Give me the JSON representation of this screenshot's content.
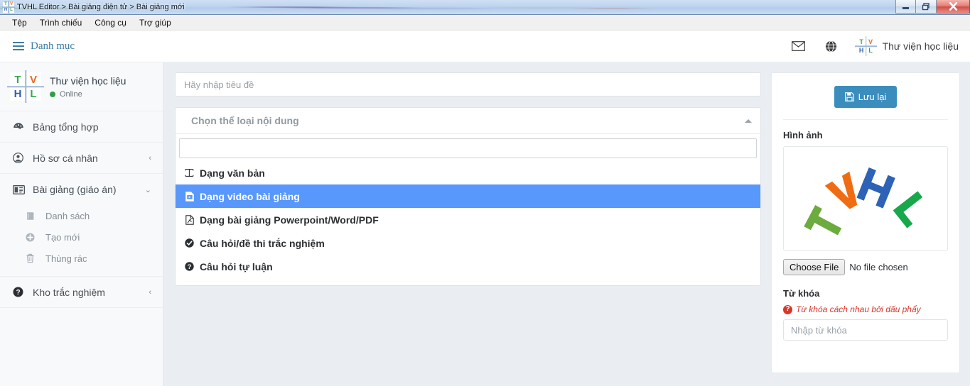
{
  "window": {
    "title": "TVHL Editor > Bài giảng điện tử > Bài giảng mới",
    "minimize_label": "Minimize",
    "restore_label": "Restore",
    "close_label": "Close"
  },
  "menubar": {
    "items": [
      {
        "label": "Tệp"
      },
      {
        "label": "Trình chiếu"
      },
      {
        "label": "Công cụ"
      },
      {
        "label": "Trợ giúp"
      }
    ]
  },
  "header": {
    "menu_toggle_label": "Danh mục",
    "mail_icon": "envelope-icon",
    "globe_icon": "globe-icon",
    "user_name": "Thư viện học liệu"
  },
  "logo": {
    "t": "T",
    "v": "V",
    "h": "H",
    "l": "L"
  },
  "sidebar": {
    "profile": {
      "name": "Thư viện học liệu",
      "status": "Online"
    },
    "items": [
      {
        "label": "Bảng tổng hợp",
        "icon": "dashboard-icon",
        "caret": ""
      },
      {
        "label": "Hồ sơ cá nhân",
        "icon": "user-circle-icon",
        "caret": "‹"
      },
      {
        "label": "Bài giảng (giáo án)",
        "icon": "book-open-icon",
        "caret": "⌄"
      },
      {
        "label": "Kho trắc nghiệm",
        "icon": "question-circle-icon",
        "caret": "‹"
      }
    ],
    "sub_items": [
      {
        "label": "Danh sách",
        "icon": "book-icon"
      },
      {
        "label": "Tạo mới",
        "icon": "plus-circle-icon"
      },
      {
        "label": "Thùng rác",
        "icon": "trash-icon"
      }
    ]
  },
  "form": {
    "title_placeholder": "Hãy nhập tiêu đề",
    "title_value": "",
    "select_label": "Chọn thể loại nội dung",
    "select_caret_icon": "caret-up-icon",
    "search_value": "",
    "search_placeholder": "",
    "options": [
      {
        "label": "Dạng văn bản",
        "icon": "text-height-icon",
        "selected": false
      },
      {
        "label": "Dạng video bài giảng",
        "icon": "video-file-icon",
        "selected": true
      },
      {
        "label": "Dạng bài giảng Powerpoint/Word/PDF",
        "icon": "pdf-file-icon",
        "selected": false
      },
      {
        "label": "Câu hỏi/đề thi trắc nghiệm",
        "icon": "check-circle-icon",
        "selected": false
      },
      {
        "label": "Câu hỏi tự luận",
        "icon": "question-circle-icon",
        "selected": false
      }
    ]
  },
  "panel": {
    "save_label": "Lưu lại",
    "save_icon": "floppy-disk-icon",
    "image_label": "Hình ảnh",
    "image_alt": "TVHL arc logo",
    "choose_file_label": "Choose File",
    "no_file_label": "No file chosen",
    "keyword_label": "Từ khóa",
    "keyword_hint": "Từ khóa cách nhau bởi dấu phẩy",
    "keyword_hint_icon": "question-mark-badge-icon",
    "keyword_placeholder": "Nhập từ khóa",
    "keyword_value": ""
  },
  "colors": {
    "accent_blue": "#3b8dbd",
    "highlight_blue": "#5897fb",
    "link_blue": "#3d7ea6",
    "danger_red": "#d9372a",
    "online_green": "#2f9e44",
    "logo_green": "#36a852",
    "logo_orange": "#ea6a1e",
    "logo_blue": "#2b5fb4",
    "main_bg": "#eaedf1",
    "sidebar_bg": "#f8f9fa"
  }
}
